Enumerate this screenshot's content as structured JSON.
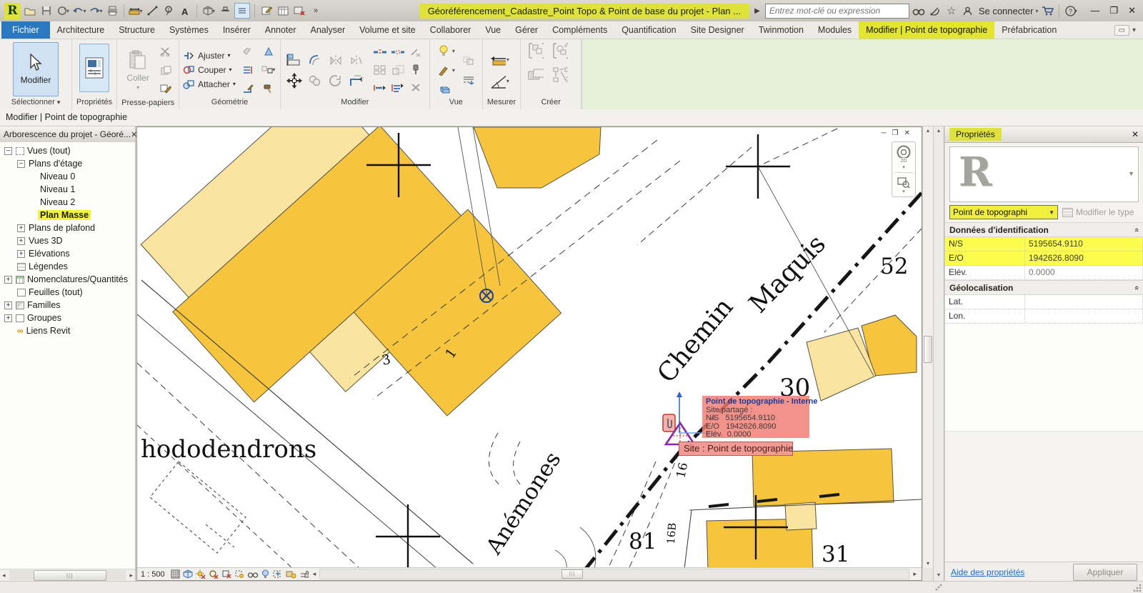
{
  "titlebar": {
    "title": "Géoréférencement_Cadastre_Point Topo & Point de base du projet - Plan ...",
    "search_placeholder": "Entrez mot-clé ou expression",
    "signin_label": "Se connecter",
    "qat_icons": [
      "revit-logo",
      "open-icon",
      "save-icon",
      "sync-icon",
      "undo-icon",
      "redo-icon",
      "print-icon",
      "measure-icon",
      "aligned-dimension-icon",
      "tag-icon",
      "text-icon",
      "default-3d-view-icon",
      "section-icon",
      "thin-lines-icon",
      "sketch-icon",
      "schedule-icon",
      "close-hidden-windows-icon",
      "more-chevron-icon"
    ],
    "right_icons": [
      "search-binoculars-icon",
      "communication-icon",
      "favorites-star-icon",
      "account-icon",
      "cart-icon",
      "help-icon",
      "minimize-icon",
      "maximize-icon",
      "close-icon"
    ]
  },
  "tabs": {
    "items": [
      {
        "label": "Fichier"
      },
      {
        "label": "Architecture"
      },
      {
        "label": "Structure"
      },
      {
        "label": "Systèmes"
      },
      {
        "label": "Insérer"
      },
      {
        "label": "Annoter"
      },
      {
        "label": "Analyser"
      },
      {
        "label": "Volume et site"
      },
      {
        "label": "Collaborer"
      },
      {
        "label": "Vue"
      },
      {
        "label": "Gérer"
      },
      {
        "label": "Compléments"
      },
      {
        "label": "Quantification"
      },
      {
        "label": "Site Designer"
      },
      {
        "label": "Twinmotion"
      },
      {
        "label": "Modules"
      },
      {
        "label": "Modifier | Point de topographie"
      },
      {
        "label": "Préfabrication"
      }
    ]
  },
  "ribbon": {
    "select_panel": {
      "button": "Modifier",
      "caption": "Sélectionner"
    },
    "properties_panel": {
      "caption": "Propriétés"
    },
    "clipboard_panel": {
      "button": "Coller",
      "caption": "Presse-papiers"
    },
    "geometry_panel": {
      "caption": "Géométrie",
      "btn_ajuster": "Ajuster",
      "btn_couper": "Couper",
      "btn_attacher": "Attacher"
    },
    "modify_panel": {
      "caption": "Modifier"
    },
    "view_panel": {
      "caption": "Vue"
    },
    "measure_panel": {
      "caption": "Mesurer"
    },
    "create_panel": {
      "caption": "Créer"
    }
  },
  "options_bar": {
    "text": "Modifier | Point de topographie"
  },
  "browser": {
    "header": "Arborescence du projet - Géoré...",
    "items": [
      {
        "label": "Vues (tout)"
      },
      {
        "label": "Plans d'étage"
      },
      {
        "label": "Niveau 0"
      },
      {
        "label": "Niveau 1"
      },
      {
        "label": "Niveau 2"
      },
      {
        "label": "Plan Masse"
      },
      {
        "label": "Plans de plafond"
      },
      {
        "label": "Vues 3D"
      },
      {
        "label": "Elévations"
      },
      {
        "label": "Légendes"
      },
      {
        "label": "Nomenclatures/Quantités"
      },
      {
        "label": "Feuilles (tout)"
      },
      {
        "label": "Familles"
      },
      {
        "label": "Groupes"
      },
      {
        "label": "Liens Revit"
      }
    ]
  },
  "canvas": {
    "scale": "1 : 500",
    "labels": {
      "rhodo": "hododendrons",
      "anemones": "Anémones",
      "chemin": "Chemin",
      "maquis": "Maquis",
      "n52": "52",
      "n30": "30",
      "n81": "81",
      "n31": "31",
      "n3": "3",
      "n1": "1",
      "n16": "16",
      "n16b": "16B"
    },
    "tooltip": {
      "line1": "Point de topographie - Interne",
      "line2": "Site partagé :",
      "ns_label": "N/S",
      "ns_value": "5195654.9110",
      "eo_label": "E/O",
      "eo_value": "1942626.8090",
      "elev_label": "Elév.",
      "elev_value": "0.0000"
    },
    "tag": "Site : Point de topographie",
    "viewbar_icons": [
      "detail-level-icon",
      "visual-style-icon",
      "sun-path-off-icon",
      "shadows-off-icon",
      "crop-view-off-icon",
      "show-crop-icon",
      "reveal-hidden-icon",
      "temporary-hide-icon",
      "reveal-constraints-icon",
      "worksharing-display-icon",
      "interference-lock-icon"
    ]
  },
  "properties": {
    "header": "Propriétés",
    "type_name": "Point de topographi",
    "modify_type": "Modifier le type",
    "sections": [
      {
        "title": "Données d'identification",
        "rows": [
          {
            "label": "N/S",
            "value": "5195654.9110"
          },
          {
            "label": "E/O",
            "value": "1942626.8090"
          },
          {
            "label": "Elév.",
            "value": "0.0000"
          }
        ]
      },
      {
        "title": "Géolocalisation",
        "rows": [
          {
            "label": "Lat.",
            "value": ""
          },
          {
            "label": "Lon.",
            "value": ""
          }
        ]
      }
    ],
    "help_link": "Aide des propriétés",
    "apply_button": "Appliquer"
  },
  "colors": {
    "highlight_yellow": "#dfe23a",
    "row_yellow": "#fcfc4e",
    "file_tab_blue": "#2a78be",
    "building_dark": "#f6c53d",
    "building_pale": "#fbe3a0",
    "tooltip_red": "#f07b74",
    "contextual_green": "#e6efda"
  }
}
